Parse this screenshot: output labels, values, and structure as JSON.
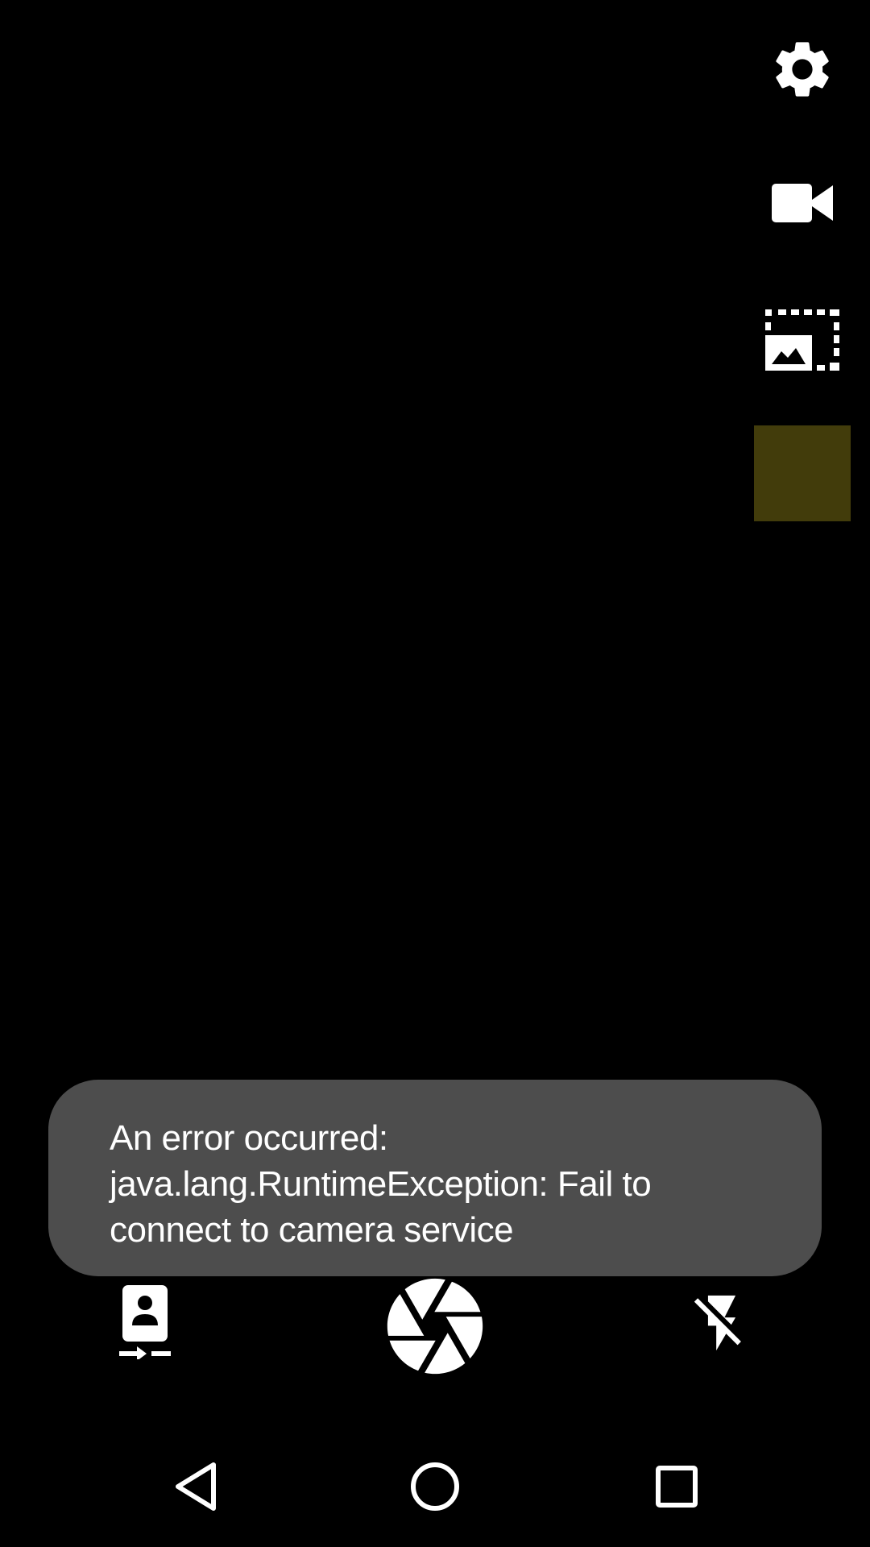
{
  "screen": {
    "background": "#000000"
  },
  "right_controls": {
    "settings": {
      "icon": "gear-icon"
    },
    "video_mode": {
      "icon": "video-camera-icon"
    },
    "preview_size": {
      "icon": "photo-size-select-icon"
    },
    "color_swatch": {
      "color": "#423c0b"
    }
  },
  "toast": {
    "line1": "An error occurred:",
    "line2": "java.lang.RuntimeException: Fail to",
    "line3": "connect to camera service",
    "background": "#4d4d4d",
    "text_color": "#ffffff"
  },
  "bottom_controls": {
    "switch_camera": {
      "icon": "switch-camera-icon"
    },
    "shutter": {
      "icon": "shutter-aperture-icon"
    },
    "flash": {
      "icon": "flash-off-icon"
    }
  },
  "nav_bar": {
    "back": {
      "icon": "back-triangle-icon"
    },
    "home": {
      "icon": "home-circle-icon"
    },
    "recents": {
      "icon": "recents-square-icon"
    }
  }
}
